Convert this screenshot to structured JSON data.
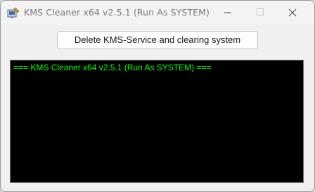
{
  "window": {
    "title": "KMS Cleaner x64 v2.5.1 (Run As SYSTEM)",
    "icon": "app-cleaner-icon",
    "controls": {
      "minimize_icon": "minimize-icon",
      "maximize_icon": "maximize-icon",
      "close_icon": "close-icon"
    }
  },
  "actions": {
    "delete_button_label": "Delete KMS-Service and clearing system"
  },
  "console": {
    "lines": [
      "=== KMS Cleaner x64 v2.5.1 (Run As SYSTEM) ==="
    ],
    "text_color": "#00ff00",
    "background_color": "#000000"
  }
}
